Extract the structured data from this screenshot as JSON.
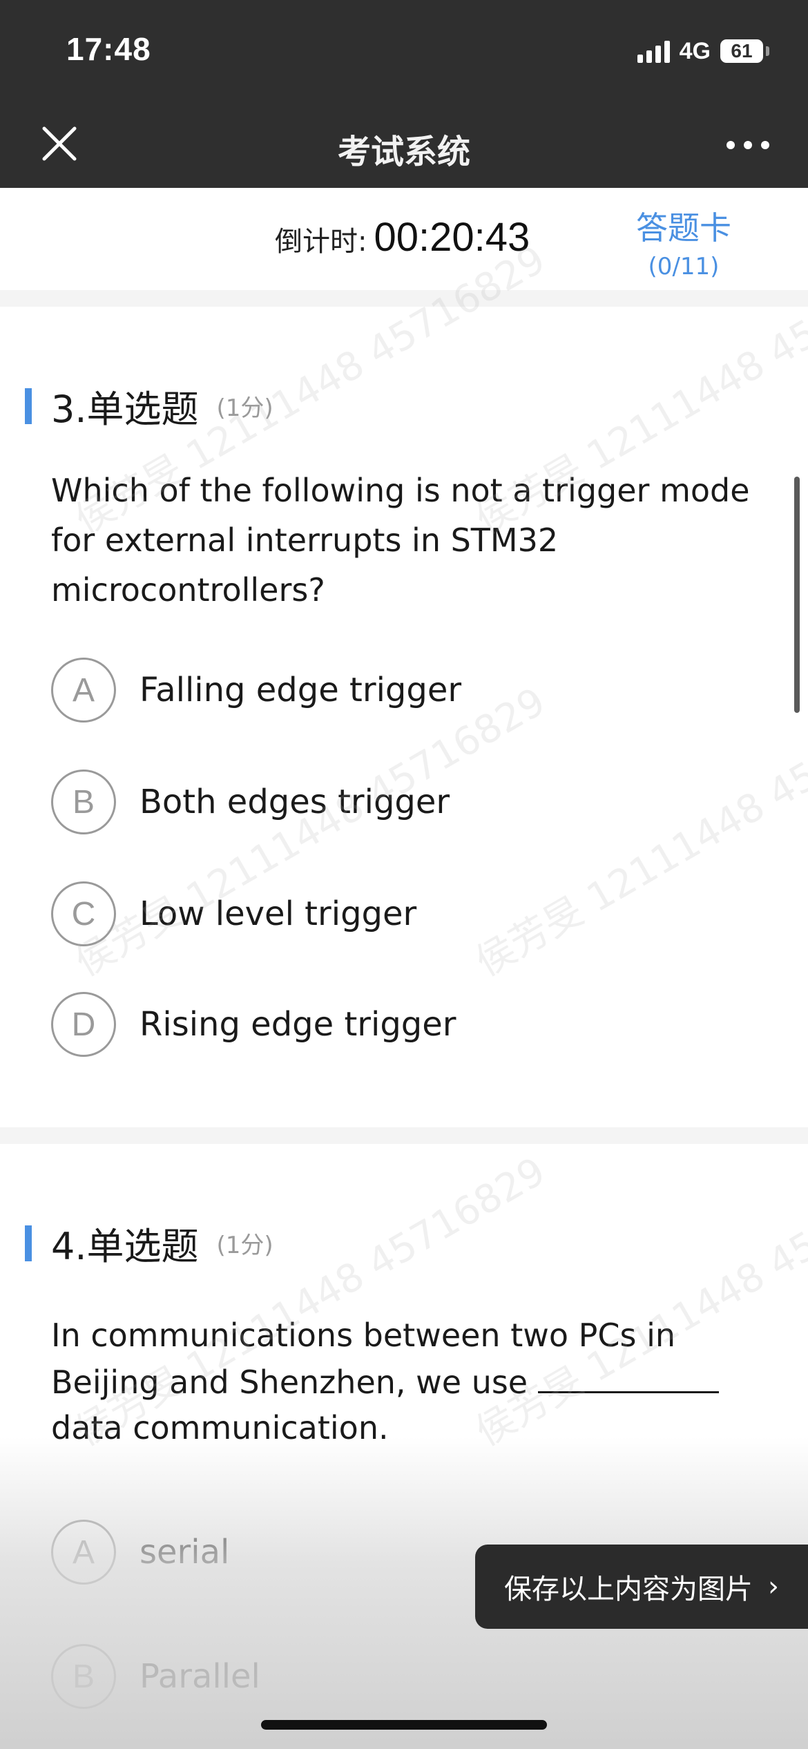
{
  "status_bar": {
    "time": "17:48",
    "network": "4G",
    "battery": "61",
    "battery_level_percent": 61
  },
  "nav": {
    "title": "考试系统",
    "close_icon": "close-icon",
    "more_icon": "more-icon"
  },
  "timer": {
    "label": "倒计时:",
    "value": "00:20:43"
  },
  "answer_card": {
    "label": "答题卡",
    "count": "(0/11)"
  },
  "questions": [
    {
      "title": "3.单选题",
      "score": "(1分)",
      "text": "Which of the following is not a trigger mode for external interrupts in STM32 microcontrollers?",
      "options": [
        {
          "letter": "A",
          "text": "Falling edge trigger"
        },
        {
          "letter": "B",
          "text": "Both edges trigger"
        },
        {
          "letter": "C",
          "text": "Low level trigger"
        },
        {
          "letter": "D",
          "text": "Rising edge trigger"
        }
      ]
    },
    {
      "title": "4.单选题",
      "score": "(1分)",
      "text_before": "In communications between two PCs in Beijing and Shenzhen, we use ",
      "text_after": " data communication.",
      "options": [
        {
          "letter": "A",
          "text": "serial"
        },
        {
          "letter": "B",
          "text": "Parallel"
        }
      ]
    }
  ],
  "save_button": {
    "label": "保存以上内容为图片",
    "chevron": "›"
  },
  "watermark": {
    "text": "侯芳旻 12111448 45716829"
  },
  "colors": {
    "accent": "#4a90e2",
    "topbar": "#2f2f2f"
  }
}
